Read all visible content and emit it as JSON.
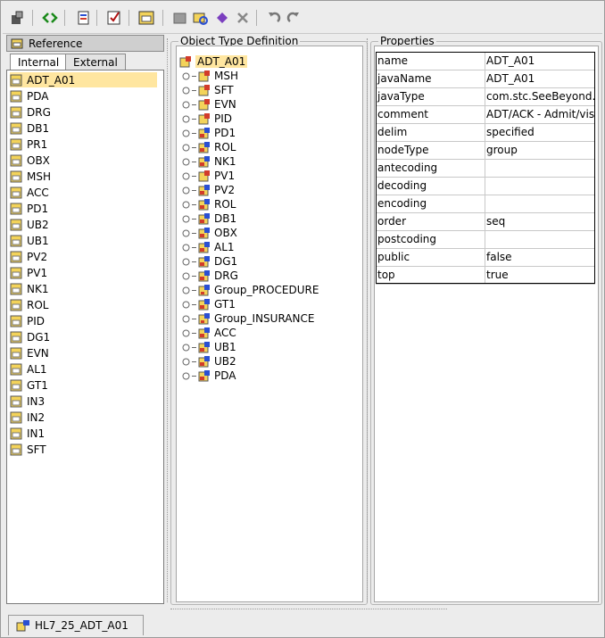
{
  "toolbar": {
    "buttons": [
      {
        "icon": "properties-icon"
      },
      {
        "icon": "code-arrows-icon"
      },
      {
        "icon": "import-icon"
      },
      {
        "icon": "validate-check-icon"
      },
      {
        "icon": "reference-icon"
      },
      {
        "icon": "new-node-icon"
      },
      {
        "icon": "find-icon"
      },
      {
        "icon": "diamond-icon"
      },
      {
        "icon": "delete-icon"
      },
      {
        "icon": "undo-icon"
      },
      {
        "icon": "redo-icon"
      }
    ]
  },
  "reference": {
    "title": "Reference",
    "tabs": [
      {
        "label": "Internal",
        "active": true
      },
      {
        "label": "External",
        "active": false
      }
    ],
    "items": [
      "ADT_A01",
      "PDA",
      "DRG",
      "DB1",
      "PR1",
      "OBX",
      "MSH",
      "ACC",
      "PD1",
      "UB2",
      "UB1",
      "PV2",
      "PV1",
      "NK1",
      "ROL",
      "PID",
      "DG1",
      "EVN",
      "AL1",
      "GT1",
      "IN3",
      "IN2",
      "IN1",
      "SFT"
    ],
    "selected": "ADT_A01"
  },
  "object_type": {
    "title": "Object Type Definition",
    "root": "ADT_A01",
    "children": [
      {
        "label": "MSH",
        "kind": "leaf"
      },
      {
        "label": "SFT",
        "kind": "leaf"
      },
      {
        "label": "EVN",
        "kind": "leaf"
      },
      {
        "label": "PID",
        "kind": "leaf"
      },
      {
        "label": "PD1",
        "kind": "ref"
      },
      {
        "label": "ROL",
        "kind": "ref"
      },
      {
        "label": "NK1",
        "kind": "ref"
      },
      {
        "label": "PV1",
        "kind": "leaf"
      },
      {
        "label": "PV2",
        "kind": "ref"
      },
      {
        "label": "ROL",
        "kind": "ref"
      },
      {
        "label": "DB1",
        "kind": "ref"
      },
      {
        "label": "OBX",
        "kind": "ref"
      },
      {
        "label": "AL1",
        "kind": "ref"
      },
      {
        "label": "DG1",
        "kind": "ref"
      },
      {
        "label": "DRG",
        "kind": "ref"
      },
      {
        "label": "Group_PROCEDURE",
        "kind": "group"
      },
      {
        "label": "GT1",
        "kind": "ref"
      },
      {
        "label": "Group_INSURANCE",
        "kind": "group"
      },
      {
        "label": "ACC",
        "kind": "ref"
      },
      {
        "label": "UB1",
        "kind": "ref"
      },
      {
        "label": "UB2",
        "kind": "ref"
      },
      {
        "label": "PDA",
        "kind": "ref"
      }
    ]
  },
  "properties": {
    "title": "Properties",
    "rows": [
      {
        "key": "name",
        "value": "ADT_A01"
      },
      {
        "key": "javaName",
        "value": "ADT_A01"
      },
      {
        "key": "javaType",
        "value": "com.stc.SeeBeyond..."
      },
      {
        "key": "comment",
        "value": "ADT/ACK - Admit/vis..."
      },
      {
        "key": "delim",
        "value": "specified"
      },
      {
        "key": "nodeType",
        "value": "group"
      },
      {
        "key": "antecoding",
        "value": ""
      },
      {
        "key": "decoding",
        "value": ""
      },
      {
        "key": "encoding",
        "value": ""
      },
      {
        "key": "order",
        "value": "seq"
      },
      {
        "key": "postcoding",
        "value": ""
      },
      {
        "key": "public",
        "value": "false"
      },
      {
        "key": "top",
        "value": "true"
      }
    ]
  },
  "document_tab": {
    "label": "HL7_25_ADT_A01",
    "icon": "otd-document-icon"
  },
  "colors": {
    "selection": "#ffe6a0",
    "panel_bg": "#ececec",
    "icon_yellow": "#f3d35a",
    "icon_red": "#d23b2a",
    "icon_blue": "#2a4fd2"
  }
}
